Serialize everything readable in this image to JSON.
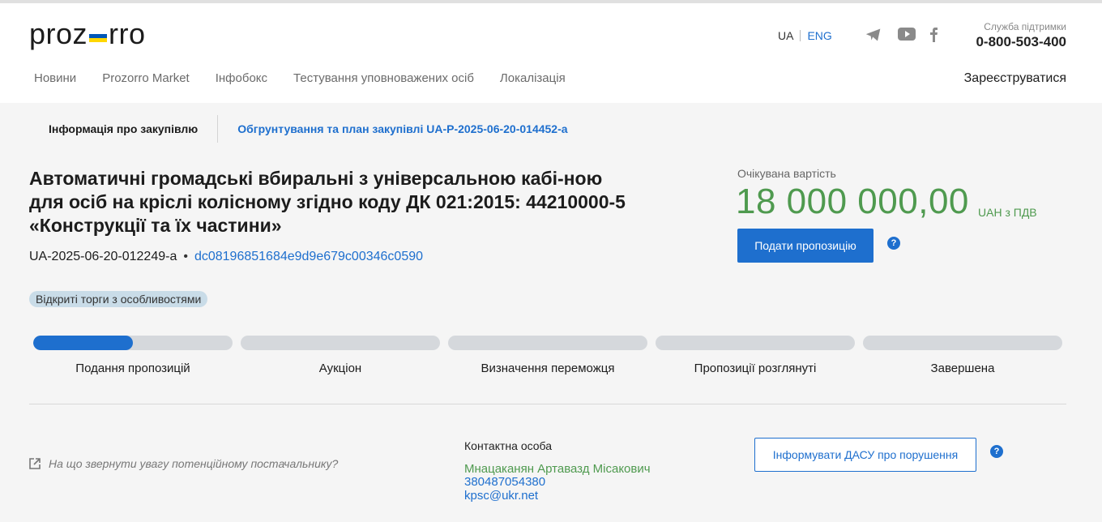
{
  "header": {
    "logo_left": "proz",
    "logo_right": "rro",
    "flag_colors": [
      "#0057b7",
      "#ffd700"
    ],
    "lang_ua": "UA",
    "lang_eng": "ENG",
    "support_label": "Служба підтримки",
    "support_phone": "0-800-503-400",
    "social_icons": [
      "telegram-icon",
      "youtube-icon",
      "facebook-icon"
    ]
  },
  "nav": {
    "items": [
      "Новини",
      "Prozorro Market",
      "Інфобокс",
      "Тестування уповноважених осіб",
      "Локалізація"
    ],
    "register": "Зареєструватися"
  },
  "tabs": {
    "active": "Інформація про закупівлю",
    "link": "Обгрунтування та план закупівлі UA-P-2025-06-20-014452-a"
  },
  "tender": {
    "title": "Автоматичні громадські вбиральні з універсальною кабі-ною для осіб на кріслі колісному згідно коду ДК 021:2015: 44210000-5 «Конструкції та їх частини»",
    "id": "UA-2025-06-20-012249-a",
    "separator": "•",
    "hash": "dc08196851684e9d9e679c00346c0590",
    "procedure": "Відкриті торги з особливостями"
  },
  "expected": {
    "label": "Очікувана вартість",
    "value": "18 000 000,00",
    "currency": "UAH з ПДВ",
    "submit_label": "Подати пропозицію",
    "help": "?"
  },
  "stages": {
    "items": [
      "Подання пропозицій",
      "Аукціон",
      "Визначення переможця",
      "Пропозиції розглянуті",
      "Завершена"
    ],
    "active_index": 0,
    "active_progress": 0.5
  },
  "footer": {
    "attention": "На що звернути увагу потенційному постачальнику?",
    "contact_heading": "Контактна особа",
    "contact_name": "Мнацаканян Артавазд Місакович",
    "contact_phone": "380487054380",
    "contact_email": "kpsc@ukr.net",
    "report_label": "Інформувати ДАСУ про порушення",
    "help": "?"
  },
  "colors": {
    "accent": "#1e6fce",
    "value_green": "#4f9a4f",
    "badge_bg": "#c9dce8"
  }
}
